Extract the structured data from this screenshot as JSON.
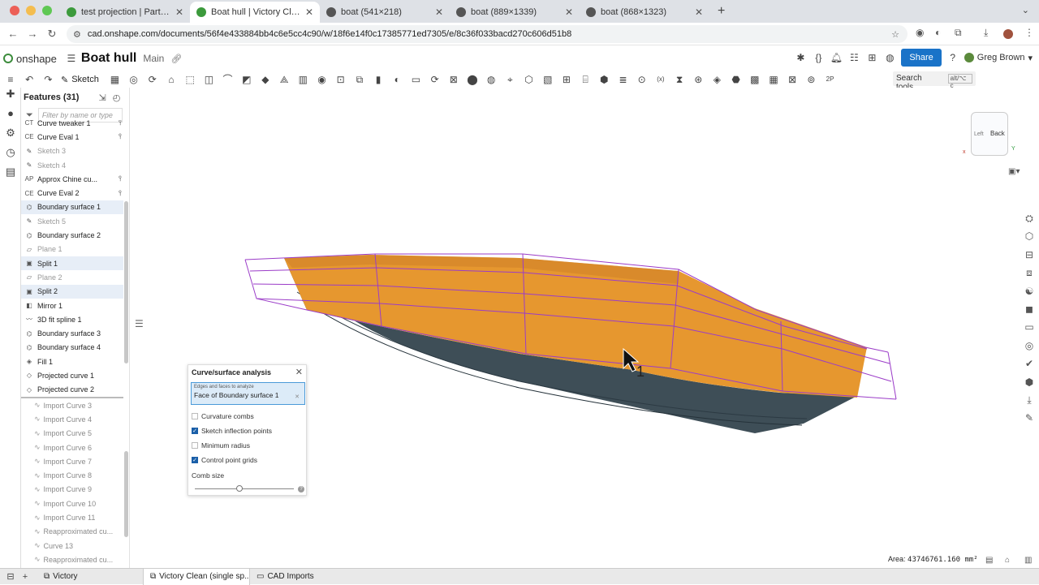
{
  "browser": {
    "tabs": [
      {
        "title": "test projection | Part Studio 1",
        "active": false,
        "color": "#3c9a3c"
      },
      {
        "title": "Boat hull | Victory Clean (sing",
        "active": true,
        "color": "#3c9a3c"
      },
      {
        "title": "boat (541×218)",
        "active": false,
        "color": "#555555"
      },
      {
        "title": "boat (889×1339)",
        "active": false,
        "color": "#555555"
      },
      {
        "title": "boat (868×1323)",
        "active": false,
        "color": "#555555"
      }
    ],
    "new_tab": "+",
    "url": "cad.onshape.com/documents/56f4e433884bb4c6e5cc4c90/w/18f6e14f0c17385771ed7305/e/8c36f033bacd270c606d51b8"
  },
  "app": {
    "logo": "onshape",
    "doc_title": "Boat hull",
    "branch": "Main",
    "share_label": "Share",
    "help": "?",
    "user": "Greg Brown",
    "sketch_label": "Sketch",
    "search_tools": "Search tools...",
    "search_shortcut": "alt/⌥ c"
  },
  "features": {
    "header": "Features (31)",
    "filter_placeholder": "Filter by name or type",
    "items": [
      {
        "label": "Curve tweaker 1",
        "icon": "CT",
        "state": "normal",
        "pin": true
      },
      {
        "label": "Curve Eval 1",
        "icon": "CE",
        "state": "normal",
        "pin": true
      },
      {
        "label": "Sketch 3",
        "icon": "✎",
        "state": "dim"
      },
      {
        "label": "Sketch 4",
        "icon": "✎",
        "state": "dim"
      },
      {
        "label": "Approx Chine cu...",
        "icon": "AP",
        "state": "normal",
        "pin": true
      },
      {
        "label": "Curve Eval 2",
        "icon": "CE",
        "state": "normal",
        "pin": true
      },
      {
        "label": "Boundary surface 1",
        "icon": "⌬",
        "state": "selected"
      },
      {
        "label": "Sketch 5",
        "icon": "✎",
        "state": "dim"
      },
      {
        "label": "Boundary surface 2",
        "icon": "⌬",
        "state": "normal"
      },
      {
        "label": "Plane 1",
        "icon": "▱",
        "state": "dim"
      },
      {
        "label": "Split 1",
        "icon": "▣",
        "state": "selected"
      },
      {
        "label": "Plane 2",
        "icon": "▱",
        "state": "dim"
      },
      {
        "label": "Split 2",
        "icon": "▣",
        "state": "selected"
      },
      {
        "label": "Mirror 1",
        "icon": "◧",
        "state": "normal"
      },
      {
        "label": "3D fit spline 1",
        "icon": "〰",
        "state": "normal"
      },
      {
        "label": "Boundary surface 3",
        "icon": "⌬",
        "state": "normal"
      },
      {
        "label": "Boundary surface 4",
        "icon": "⌬",
        "state": "normal"
      },
      {
        "label": "Fill 1",
        "icon": "◈",
        "state": "normal"
      },
      {
        "label": "Projected curve 1",
        "icon": "◇",
        "state": "normal"
      },
      {
        "label": "Projected curve 2",
        "icon": "◇",
        "state": "normal"
      }
    ],
    "rolled_items": [
      "Import Curve 3",
      "Import Curve 4",
      "Import Curve 5",
      "Import Curve 6",
      "Import Curve 7",
      "Import Curve 8",
      "Import Curve 9",
      "Import Curve 10",
      "Import Curve 11",
      "Reapproximated cu...",
      "Curve 13",
      "Reapproximated cu..."
    ]
  },
  "viewcube": {
    "face": "Back",
    "side": "Left",
    "axis_x": "x",
    "axis_y": "Y"
  },
  "dialog": {
    "title": "Curve/surface analysis",
    "field_caption": "Edges and faces to analyze",
    "field_value": "Face of Boundary surface 1",
    "options": [
      {
        "label": "Curvature combs",
        "checked": false
      },
      {
        "label": "Sketch inflection points",
        "checked": true
      },
      {
        "label": "Minimum radius",
        "checked": false
      },
      {
        "label": "Control point grids",
        "checked": true
      }
    ],
    "comb_size_label": "Comb size",
    "comb_size": 0.45
  },
  "cursor_label": "1",
  "status": {
    "area_label": "Area:",
    "area_value": "43746761.160 mm²"
  },
  "bottom_tabs": [
    {
      "label": "Victory",
      "active": false
    },
    {
      "label": "Victory Clean (single sp...",
      "active": true
    },
    {
      "label": "CAD Imports",
      "active": false
    }
  ],
  "colors": {
    "hull_top": "#e6972f",
    "hull_bottom": "#3e4e57",
    "control_grid": "#9b3cc8",
    "accent": "#1a73c8"
  }
}
